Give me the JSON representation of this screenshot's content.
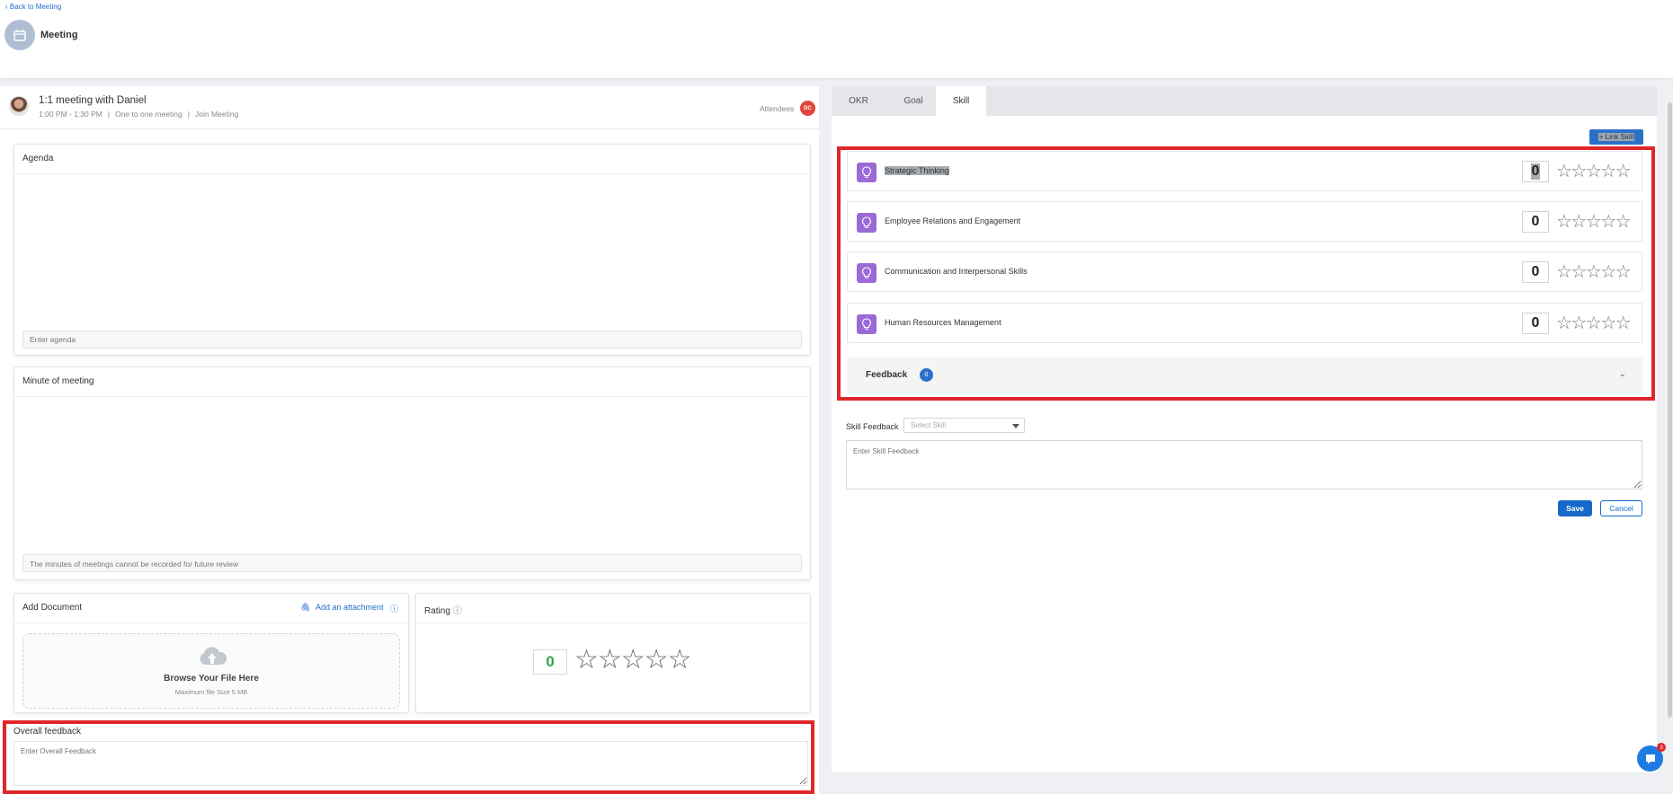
{
  "header": {
    "back_label": "Back to Meeting",
    "title": "Meeting"
  },
  "meeting": {
    "name": "1:1 meeting with Daniel",
    "time": "1:00 PM - 1:30 PM",
    "type": "One to one meeting",
    "join": "Join Meeting",
    "attendees_label": "Attendees",
    "attendee_initials": "DC"
  },
  "agenda": {
    "title": "Agenda",
    "placeholder": "Enter agenda"
  },
  "minutes": {
    "title": "Minute of meeting",
    "notice": "The minutes of meetings cannot be recorded for future review"
  },
  "document": {
    "title": "Add Document",
    "attach_label": "Add an attachment",
    "browse_label": "Browse Your File Here",
    "max_size": "Maximum file Size 5 MB"
  },
  "rating": {
    "title": "Rating",
    "value": "0",
    "max_stars": 5
  },
  "overall": {
    "title": "Overall feedback",
    "placeholder": "Enter Overall Feedback"
  },
  "tabs": [
    {
      "label": "OKR"
    },
    {
      "label": "Goal"
    },
    {
      "label": "Skill",
      "active": true
    }
  ],
  "link_skill_label": "+ Link Skill",
  "skills": [
    {
      "name": "Strategic Thinking",
      "score": "0",
      "stars": 0
    },
    {
      "name": "Employee Relations and Engagement",
      "score": "0",
      "stars": 0
    },
    {
      "name": "Communication and Interpersonal Skills",
      "score": "0",
      "stars": 0
    },
    {
      "name": "Human Resources Management",
      "score": "0",
      "stars": 0
    }
  ],
  "feedback": {
    "label": "Feedback",
    "count": "0"
  },
  "skill_feedback": {
    "label": "Skill Feedback",
    "select_placeholder": "Select Skill",
    "textarea_placeholder": "Enter Skill Feedback",
    "save_label": "Save",
    "cancel_label": "Cancel"
  },
  "chat": {
    "unread": "3"
  },
  "colors": {
    "accent": "#1668c9",
    "highlight": "#e0262b",
    "skill_icon": "#9c6ad6",
    "rating_value": "#2eaa4d"
  }
}
